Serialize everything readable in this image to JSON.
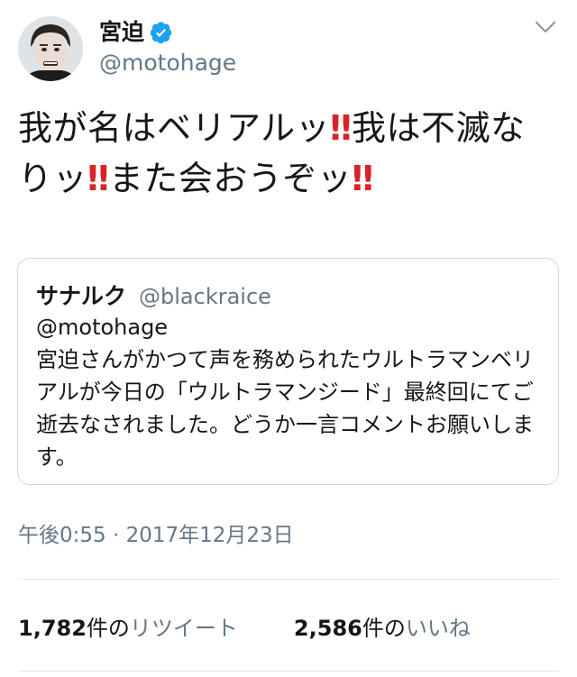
{
  "tweet": {
    "author": {
      "display_name": "宮迫",
      "handle": "@motohage",
      "verified": true,
      "verified_color": "#1da1f2"
    },
    "text_segments": [
      {
        "text": "我が名はベリアルッ",
        "emoji": false
      },
      {
        "text": "‼",
        "emoji": true
      },
      {
        "text": "我は不滅なりッ",
        "emoji": false
      },
      {
        "text": "‼",
        "emoji": true
      },
      {
        "text": "また会おうぞッ",
        "emoji": false
      },
      {
        "text": "‼",
        "emoji": true
      }
    ],
    "quoted": {
      "display_name": "サナルク",
      "handle": "@blackraice",
      "body": "@motohage\n宮迫さんがかつて声を務められたウルトラマンベリアルが今日の「ウルトラマンジード」最終回にてご逝去なされました。どうか一言コメントお願いします。"
    },
    "timestamp": "午後0:55 · 2017年12月23日",
    "stats": {
      "retweets": {
        "count": "1,782",
        "unit": "件の",
        "label": "リツイート"
      },
      "likes": {
        "count": "2,586",
        "unit": "件の",
        "label": "いいね"
      }
    },
    "colors": {
      "text": "#14171a",
      "secondary": "#657786",
      "border": "#cfd9de",
      "emphasis_red": "#d8232a"
    }
  },
  "icons": {
    "verified": "verified-badge-icon",
    "caret": "chevron-down-icon",
    "avatar": "profile-avatar"
  }
}
